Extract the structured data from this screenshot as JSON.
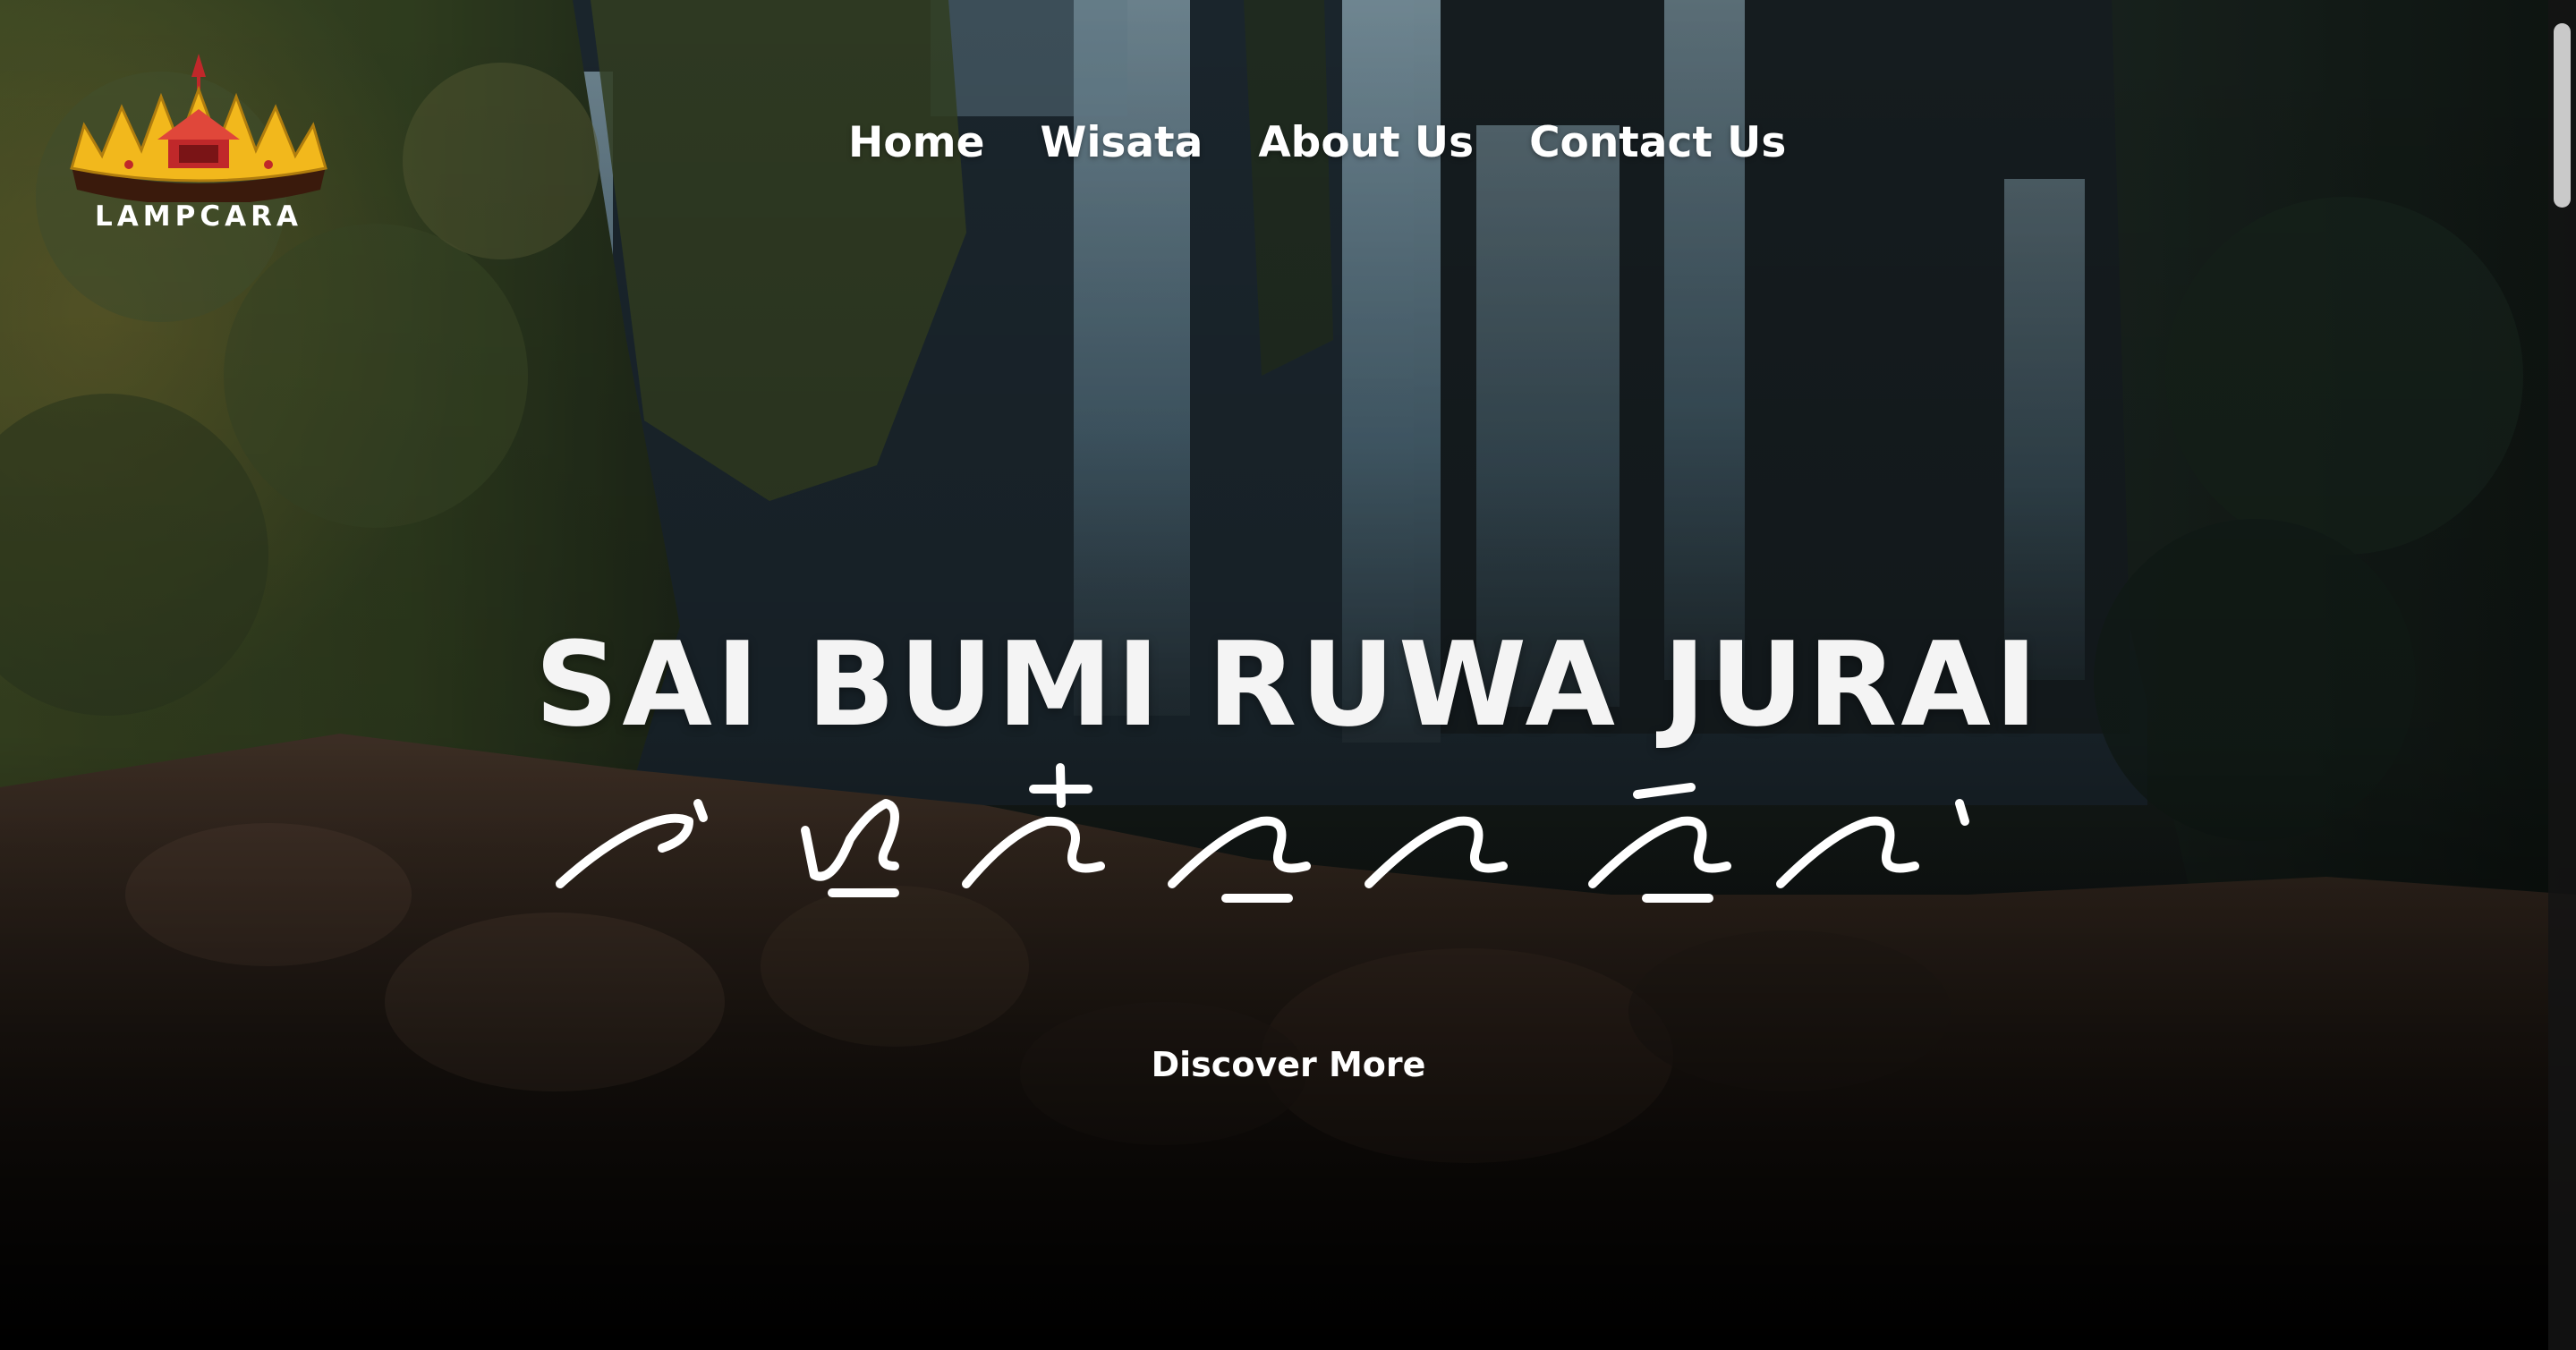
{
  "brand": {
    "name": "LAMPCARA",
    "logo_colors": {
      "gold": "#f2b81c",
      "red": "#c0282a",
      "dark": "#3a1a0c"
    }
  },
  "nav": {
    "items": [
      {
        "label": "Home"
      },
      {
        "label": "Wisata"
      },
      {
        "label": "About Us"
      },
      {
        "label": "Contact Us"
      }
    ]
  },
  "hero": {
    "title": "SAI BUMI RUWA JURAI",
    "cta_label": "Discover More",
    "colors": {
      "text": "#ffffff",
      "overlay_bottom": "#000000"
    }
  }
}
